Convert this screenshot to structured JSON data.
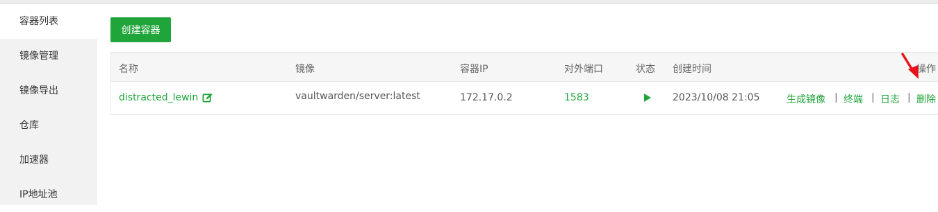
{
  "sidebar": {
    "items": [
      {
        "label": "容器列表",
        "active": true
      },
      {
        "label": "镜像管理"
      },
      {
        "label": "镜像导出"
      },
      {
        "label": "仓库"
      },
      {
        "label": "加速器"
      },
      {
        "label": "IP地址池"
      }
    ]
  },
  "toolbar": {
    "create_label": "创建容器"
  },
  "table": {
    "headers": {
      "name": "名称",
      "image": "镜像",
      "ip": "容器IP",
      "port": "对外端口",
      "status": "状态",
      "created": "创建时间",
      "actions": "操作"
    },
    "rows": [
      {
        "name": "distracted_lewin",
        "image": "vaultwarden/server:latest",
        "ip": "172.17.0.2",
        "port": "1583",
        "status_icon": "play-icon",
        "created": "2023/10/08 21:05",
        "actions": {
          "commit": "生成镜像",
          "terminal": "终端",
          "logs": "日志",
          "delete": "删除",
          "separator": "|"
        }
      }
    ]
  },
  "colors": {
    "accent": "#20a53a",
    "annotation_arrow": "#e8131a"
  }
}
